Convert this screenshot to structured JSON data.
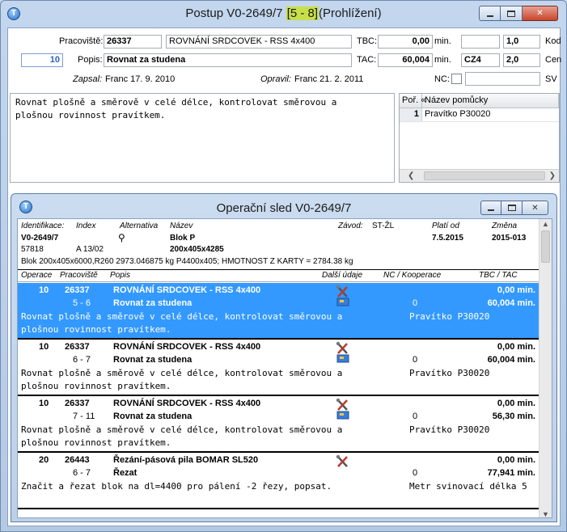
{
  "window": {
    "title_prefix": "Postup V0-2649/7",
    "title_highlight": "[5 - 8]",
    "title_suffix": "(Prohlížení)"
  },
  "form": {
    "pracoviste_label": "Pracoviště:",
    "pracoviste_code": "26337",
    "pracoviste_name": "ROVNÁNÍ SRDCOVEK - RSS 4x400",
    "tbc_label": "TBC:",
    "tbc_value": "0,00",
    "tbc_unit": "min.",
    "tbc_extra": "",
    "tbc_coef": "1,0",
    "kod_label": "Kod",
    "op_number": "10",
    "popis_label": "Popis:",
    "popis_value": "Rovnat za studena",
    "tac_label": "TAC:",
    "tac_value": "60,004",
    "tac_unit": "min.",
    "tac_extra": "CZ4",
    "tac_coef": "2,0",
    "cen_label": "Cen",
    "zapsal_label": "Zapsal:",
    "zapsal_value": "Franc 17. 9. 2010",
    "opravil_label": "Opravil:",
    "opravil_value": "Franc 21. 2. 2011",
    "nc_label": "NC:",
    "sv_label": "SV"
  },
  "memo_text": "Rovnat plošně a směrově v celé délce, kontrolovat směrovou a\nplošnou rovinnost pravítkem.",
  "pomucky": {
    "col_por": "Poř. «",
    "col_name": "Název pomůcky",
    "rows": [
      {
        "num": "1",
        "name": "Pravítko P30020"
      }
    ]
  },
  "child": {
    "title": "Operační sled V0-2649/7",
    "hdr": {
      "identifikace_label": "Identifikace:",
      "index_label": "Index",
      "alternativa_label": "Alternativa",
      "nazev_label": "Název",
      "zavod_label": "Závod:",
      "zavod_value": "ST-ŽL",
      "plati_label": "Platí od",
      "zmena_label": "Změna",
      "id_value": "V0-2649/7",
      "nazev_value": "Blok P",
      "plati_value": "7.5.2015",
      "zmena_value": "2015-013",
      "sub_id": "57818",
      "index_value": "A 13/02",
      "rozmer": "200x405x4285",
      "note": "Blok 200x405x6000,R260 2973.046875 kg P4400x405; HMOTNOST Z KARTY = 2784.38 kg"
    },
    "columns": {
      "operace": "Operace",
      "pracoviste": "Pracoviště",
      "popis": "Popis",
      "dalsi": "Další údaje",
      "nc": "NC / Kooperace",
      "tbctac": "TBC / TAC"
    },
    "operations": [
      {
        "op": "10",
        "code": "26337",
        "name": "ROVNÁNÍ SRDCOVEK - RSS 4x400",
        "range": "5 - 6",
        "desc": "Rovnat za studena",
        "nc": "0",
        "tbc": "0,00 min.",
        "tac": "60,004 min.",
        "text1": "Rovnat plošně a směrově v celé délce, kontrolovat směrovou a",
        "text2": "plošnou rovinnost pravítkem.",
        "tool": "Pravítko P30020",
        "tool2": ""
      },
      {
        "op": "10",
        "code": "26337",
        "name": "ROVNÁNÍ SRDCOVEK - RSS 4x400",
        "range": "6 - 7",
        "desc": "Rovnat za studena",
        "nc": "0",
        "tbc": "0,00 min.",
        "tac": "60,004 min.",
        "text1": "Rovnat plošně a směrově v celé délce, kontrolovat směrovou a",
        "text2": "plošnou rovinnost pravítkem.",
        "tool": "Pravítko P30020",
        "tool2": ""
      },
      {
        "op": "10",
        "code": "26337",
        "name": "ROVNÁNÍ SRDCOVEK - RSS 4x400",
        "range": "7 - 11",
        "desc": "Rovnat za studena",
        "nc": "0",
        "tbc": "0,00 min.",
        "tac": "56,30 min.",
        "text1": "Rovnat plošně a směrově v celé délce, kontrolovat směrovou a",
        "text2": "plošnou rovinnost pravítkem.",
        "tool": "Pravítko P30020",
        "tool2": ""
      },
      {
        "op": "20",
        "code": "26443",
        "name": "Řezání-pásová pila BOMAR SL520",
        "range": "6 - 7",
        "desc": "Řezat",
        "nc": "0",
        "tbc": "0,00 min.",
        "tac": "77,941 min.",
        "text1": "Značit a řezat blok na dl=4400 pro pálení -2 řezy, popsat.",
        "text2": "",
        "tool": "Metr svinovací délka 5",
        "tool2": ""
      }
    ]
  }
}
